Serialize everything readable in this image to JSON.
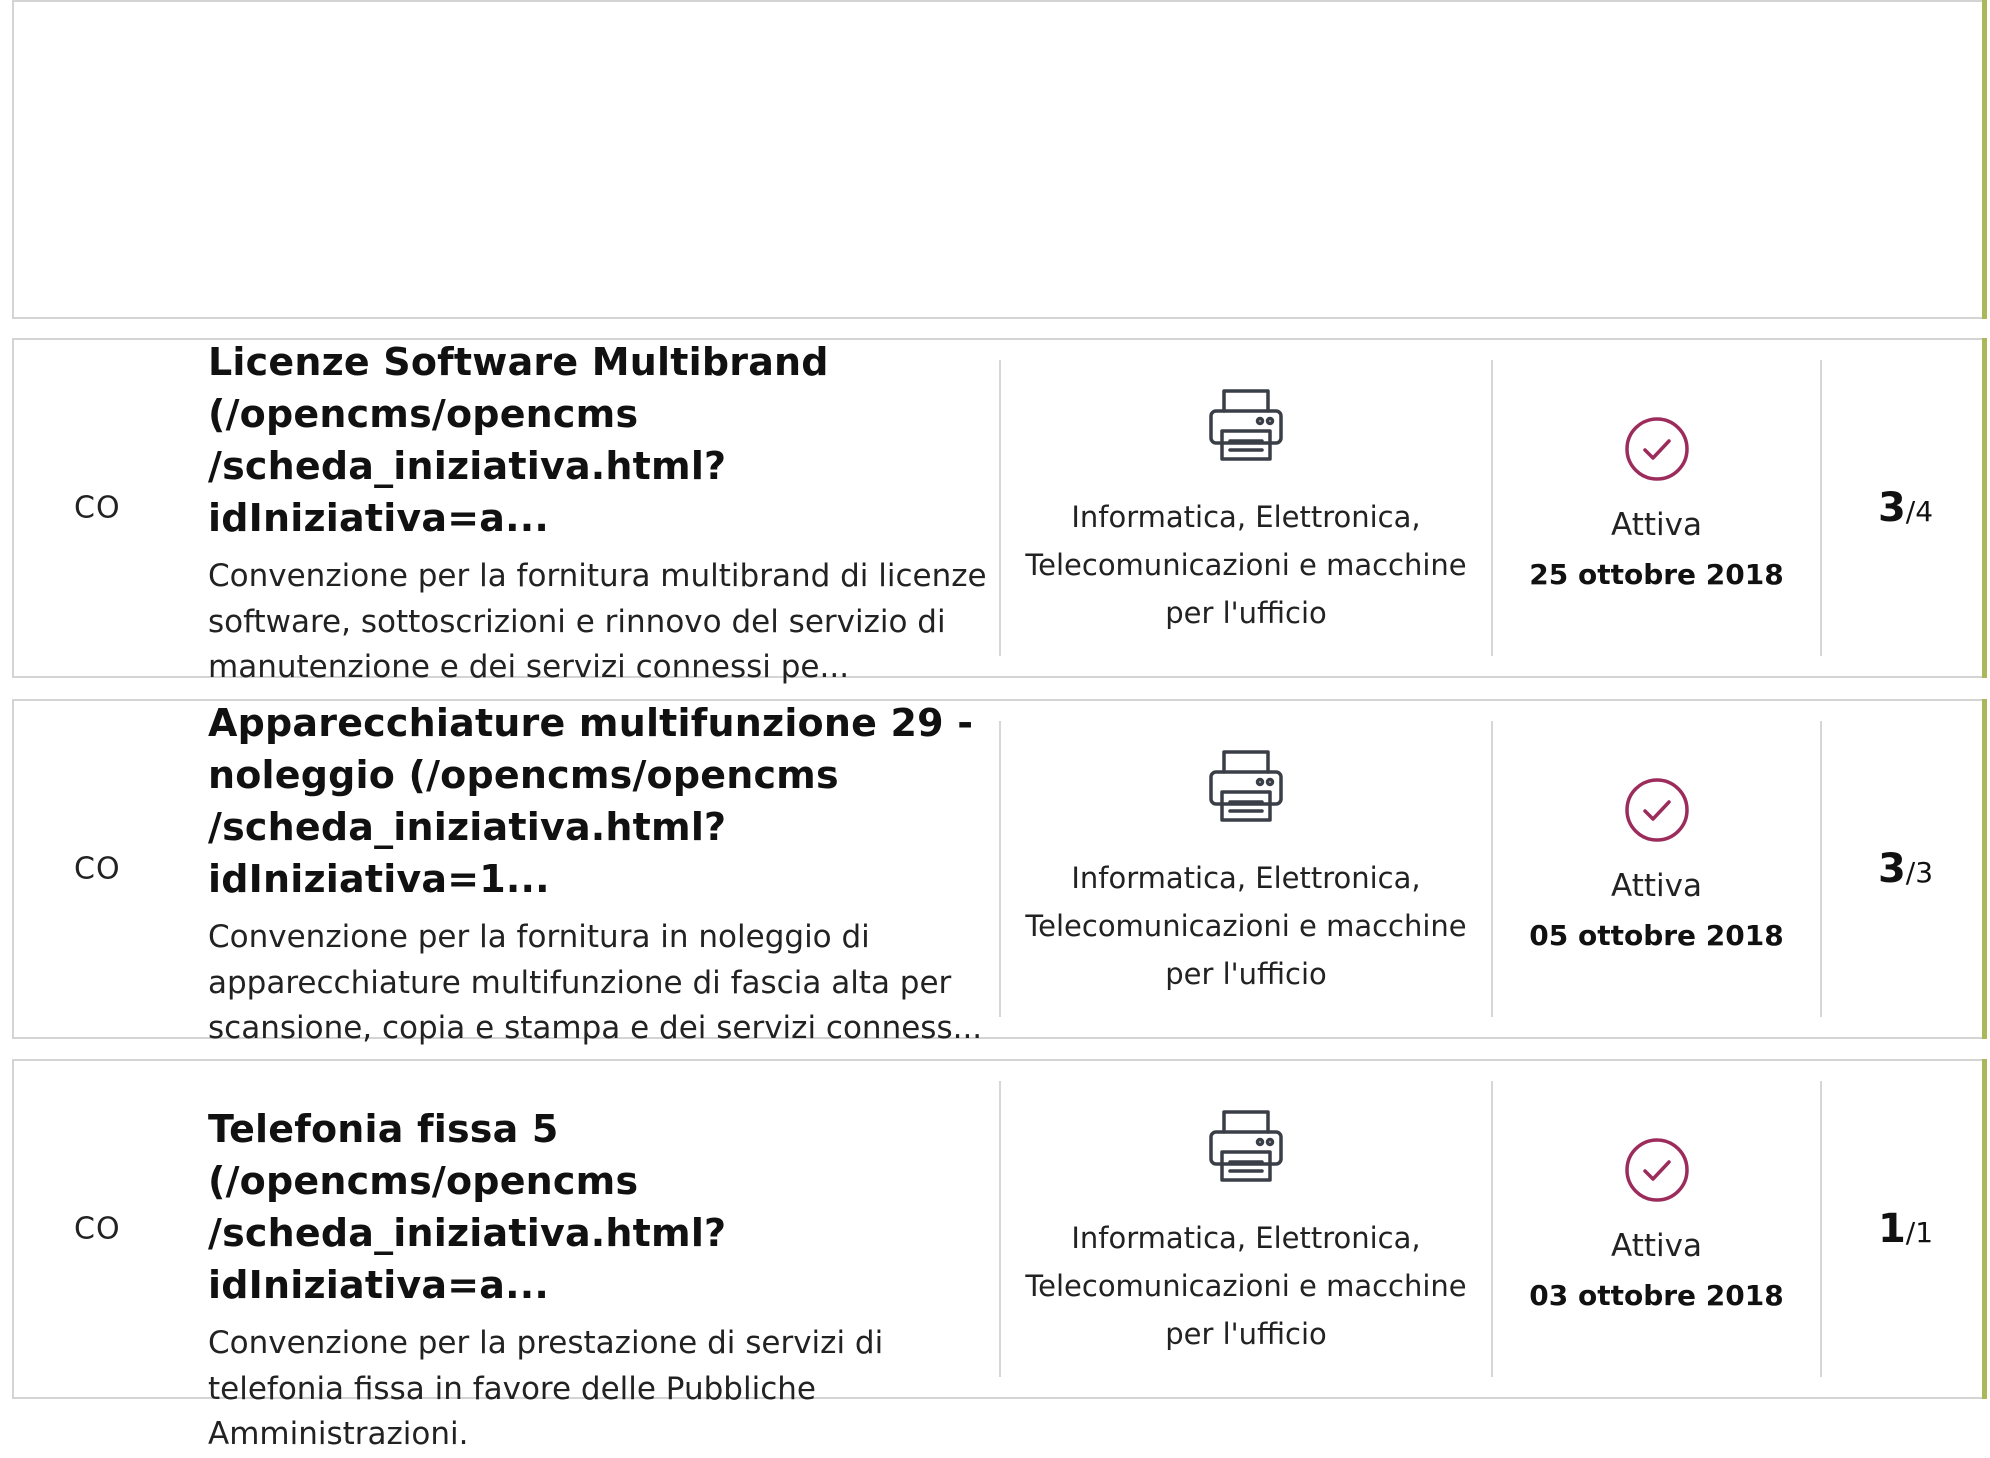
{
  "rows": [
    {
      "code": "CO",
      "title": "Licenze Software Multibrand (/opencms/opencms /scheda_iniziativa.html?idIniziativa=a...",
      "description": "Convenzione per la fornitura multibrand di licenze software, sottoscrizioni e rinnovo del servizio di manutenzione e dei servizi connessi pe...",
      "category_icon": "printer-icon",
      "category": "Informatica, Elettronica, Telecomunicazioni e macchine per l'ufficio",
      "status_icon": "check-circle-icon",
      "status": "Attiva",
      "date": "25 ottobre 2018",
      "count": "3",
      "count_total": "/4"
    },
    {
      "code": "CO",
      "title": "Apparecchiature multifunzione 29 - noleggio (/opencms/opencms /scheda_iniziativa.html?idIniziativa=1...",
      "description": "Convenzione per la fornitura in noleggio di apparecchiature multifunzione di fascia alta per scansione, copia e stampa e dei servizi conness...",
      "category_icon": "printer-icon",
      "category": "Informatica, Elettronica, Telecomunicazioni e macchine per l'ufficio",
      "status_icon": "check-circle-icon",
      "status": "Attiva",
      "date": "05 ottobre 2018",
      "count": "3",
      "count_total": "/3"
    },
    {
      "code": "CO",
      "title": "Telefonia fissa 5 (/opencms/opencms /scheda_iniziativa.html?idIniziativa=a...",
      "description": "Convenzione per la prestazione di servizi di telefonia fissa in favore delle Pubbliche Amministrazioni.",
      "category_icon": "printer-icon",
      "category": "Informatica, Elettronica, Telecomunicazioni e macchine per l'ufficio",
      "status_icon": "check-circle-icon",
      "status": "Attiva",
      "date": "03 ottobre 2018",
      "count": "1",
      "count_total": "/1"
    }
  ],
  "colors": {
    "accent_bar": "#a9b85a",
    "status_icon": "#9b2c5c",
    "border": "#d4d4d4"
  }
}
